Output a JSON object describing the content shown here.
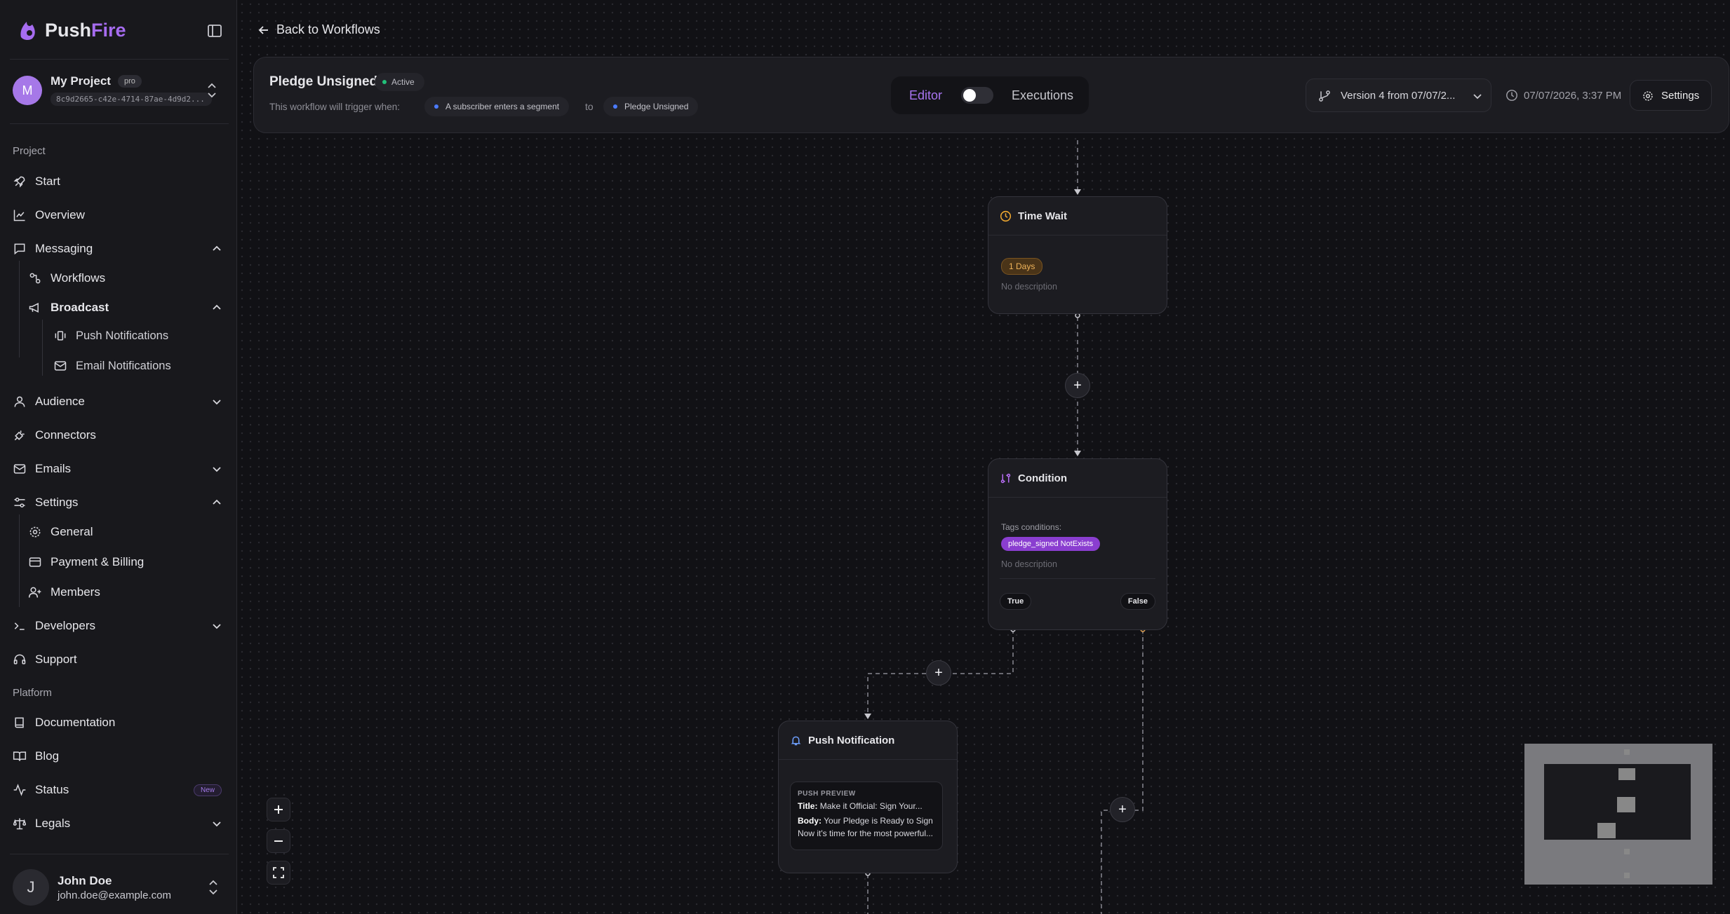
{
  "app": {
    "brand_push": "Push",
    "brand_fire": "Fire"
  },
  "project": {
    "name": "My Project",
    "plan": "pro",
    "id": "8c9d2665-c42e-4714-87ae-4d9d2..."
  },
  "sidebar": {
    "section_project": "Project",
    "section_platform": "Platform",
    "items": {
      "start": "Start",
      "overview": "Overview",
      "messaging": "Messaging",
      "workflows": "Workflows",
      "broadcast": "Broadcast",
      "push_notifications": "Push Notifications",
      "email_notifications": "Email Notifications",
      "audience": "Audience",
      "connectors": "Connectors",
      "emails": "Emails",
      "settings": "Settings",
      "general": "General",
      "payment_billing": "Payment & Billing",
      "members": "Members",
      "developers": "Developers",
      "support": "Support",
      "documentation": "Documentation",
      "blog": "Blog",
      "status": "Status",
      "status_badge": "New",
      "legals": "Legals"
    }
  },
  "user": {
    "initial": "J",
    "name": "John Doe",
    "email": "john.doe@example.com"
  },
  "header": {
    "back": "Back to Workflows",
    "workflow_title": "Pledge Unsigned",
    "status": "Active",
    "trigger_label": "This workflow will trigger when:",
    "trigger_event": "A subscriber enters a segment",
    "to": "to",
    "segment": "Pledge Unsigned",
    "mode_editor": "Editor",
    "mode_executions": "Executions",
    "version": "Version 4 from 07/07/2...",
    "timestamp": "07/07/2026, 3:37 PM",
    "settings": "Settings"
  },
  "nodes": {
    "time_wait": {
      "title": "Time Wait",
      "badge": "1 Days",
      "desc": "No description"
    },
    "condition": {
      "title": "Condition",
      "tags_label": "Tags conditions:",
      "tag": "pledge_signed NotExists",
      "desc": "No description",
      "true_label": "True",
      "false_label": "False"
    },
    "push": {
      "title": "Push Notification",
      "preview_label": "PUSH PREVIEW",
      "title_key": "Title:",
      "title_value": "Make it Official: Sign Your...",
      "body_key": "Body:",
      "body_value": "Your Pledge is Ready to Sign",
      "body_line2": "Now it's time for the most powerful..."
    }
  },
  "colors": {
    "accent": "#a874f0",
    "active": "#22c07a",
    "segment_dot": "#4b7bff",
    "tag": "#8a3ed0",
    "days": "#f0b45a"
  }
}
